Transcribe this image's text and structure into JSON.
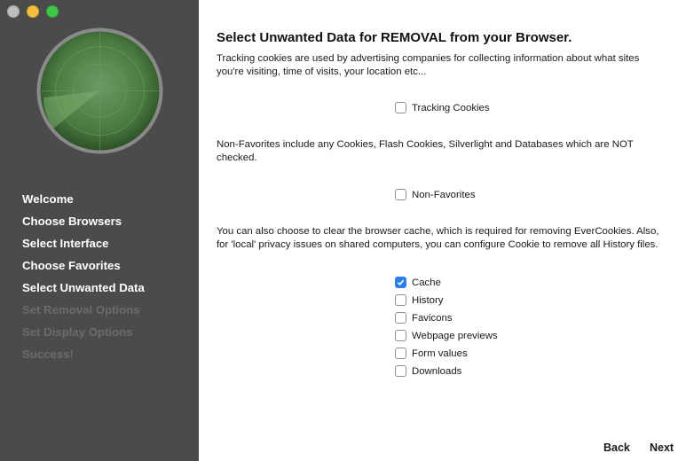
{
  "sidebar": {
    "steps": [
      {
        "label": "Welcome",
        "enabled": true
      },
      {
        "label": "Choose Browsers",
        "enabled": true
      },
      {
        "label": "Select Interface",
        "enabled": true
      },
      {
        "label": "Choose Favorites",
        "enabled": true
      },
      {
        "label": "Select Unwanted Data",
        "enabled": true
      },
      {
        "label": "Set Removal Options",
        "enabled": false
      },
      {
        "label": "Set Display Options",
        "enabled": false
      },
      {
        "label": "Success!",
        "enabled": false
      }
    ]
  },
  "main": {
    "title": "Select Unwanted Data for REMOVAL from your Browser.",
    "para1": "Tracking cookies are used by advertising companies for collecting information about what sites you're visiting, time of visits, your location etc...",
    "tracking_cookies": {
      "label": "Tracking Cookies",
      "checked": false
    },
    "para2": "Non-Favorites include any Cookies, Flash Cookies, Silverlight and Databases which are NOT checked.",
    "non_favorites": {
      "label": "Non-Favorites",
      "checked": false
    },
    "para3": "You can also choose to clear the browser cache, which is required for removing EverCookies. Also, for 'local' privacy issues on shared computers, you can configure Cookie to remove all History files.",
    "options": [
      {
        "label": "Cache",
        "checked": true
      },
      {
        "label": "History",
        "checked": false
      },
      {
        "label": "Favicons",
        "checked": false
      },
      {
        "label": "Webpage previews",
        "checked": false
      },
      {
        "label": "Form values",
        "checked": false
      },
      {
        "label": "Downloads",
        "checked": false
      }
    ]
  },
  "footer": {
    "back_label": "Back",
    "next_label": "Next"
  },
  "colors": {
    "sidebar": "#4b4b4b",
    "accent": "#2f7fea",
    "radar": "#4f7f45"
  }
}
